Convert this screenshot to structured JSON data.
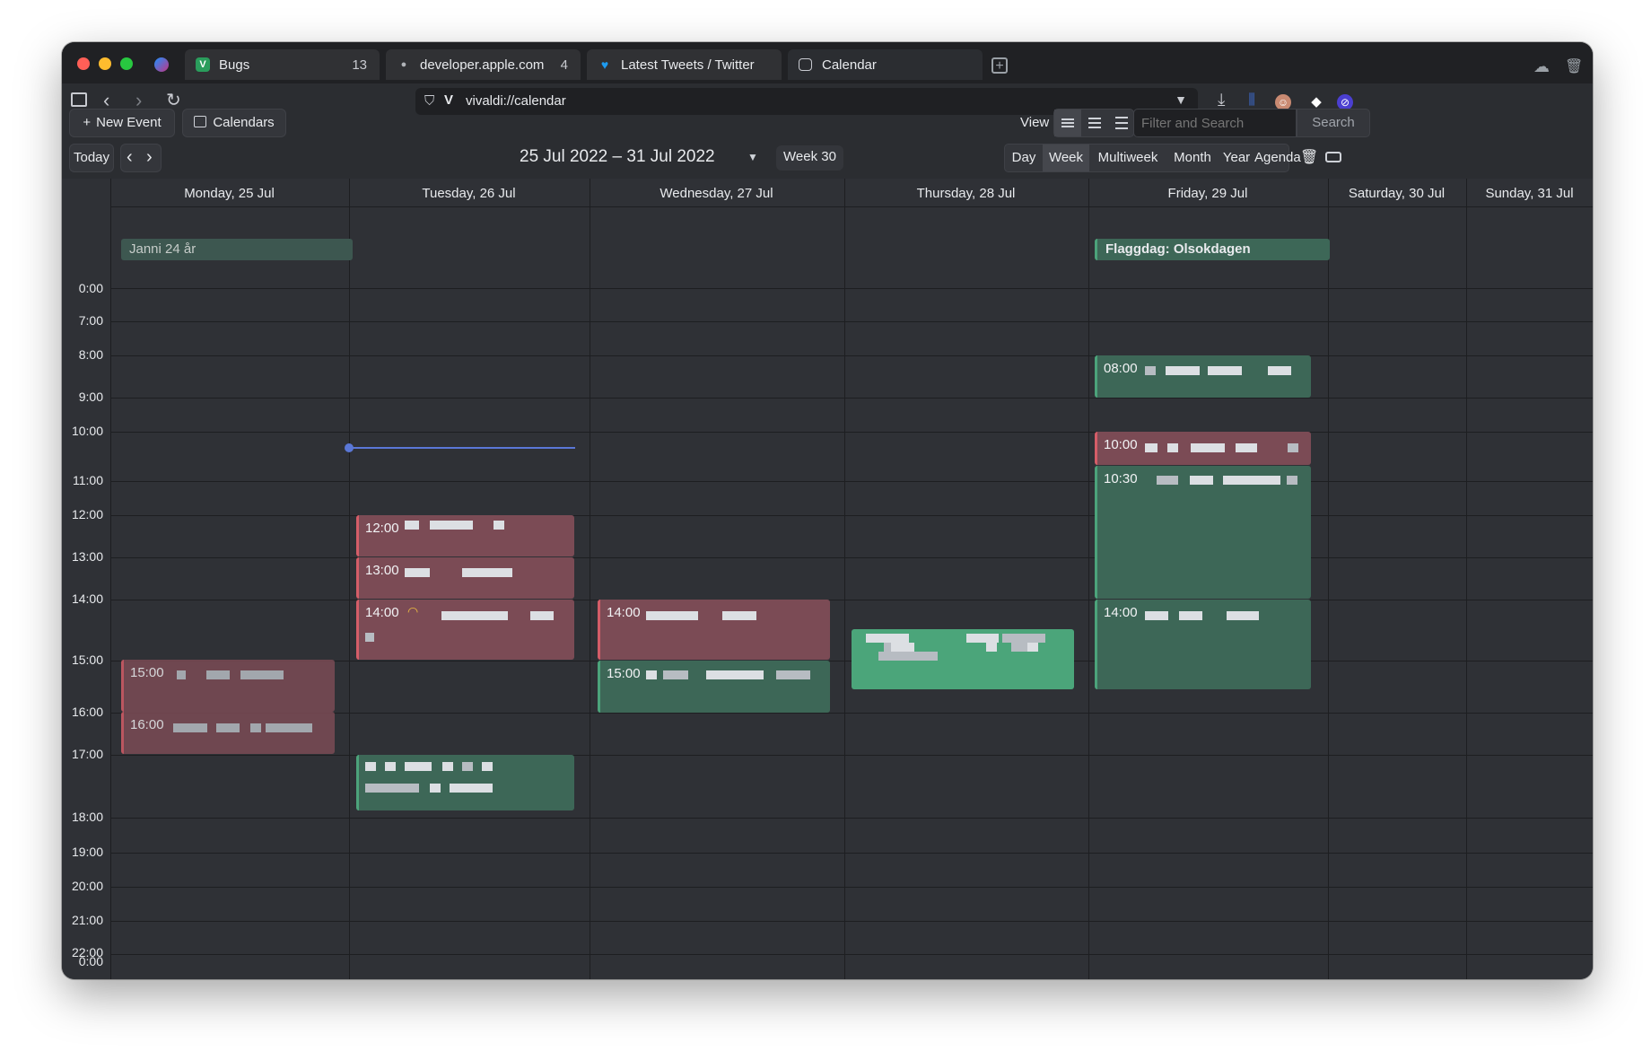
{
  "browser": {
    "tabs": [
      {
        "label": "Bugs",
        "count": "13"
      },
      {
        "label": "developer.apple.com",
        "count": "4"
      },
      {
        "label": "Latest Tweets / Twitter",
        "count": ""
      },
      {
        "label": "Calendar",
        "count": ""
      }
    ],
    "url": "vivaldi://calendar"
  },
  "toolbar": {
    "new_event": "New Event",
    "calendars": "Calendars",
    "view_label": "View",
    "search_placeholder": "Filter and Search",
    "search_button": "Search",
    "today": "Today",
    "date_range": "25 Jul 2022 – 31 Jul 2022",
    "week": "Week 30",
    "ranges": [
      "Day",
      "Week",
      "Multiweek",
      "Month",
      "Year",
      "Agenda"
    ],
    "active_range": "Week"
  },
  "days": [
    "Monday, 25 Jul",
    "Tuesday, 26 Jul",
    "Wednesday, 27 Jul",
    "Thursday, 28 Jul",
    "Friday, 29 Jul",
    "Saturday, 30 Jul",
    "Sunday, 31 Jul"
  ],
  "all_day_events": [
    {
      "day": "Monday, 25 Jul",
      "title": "Janni 24 år"
    },
    {
      "day": "Friday, 29 Jul",
      "title": "Flaggdag: Olsokdagen"
    }
  ],
  "time_labels": [
    "0:00",
    "7:00",
    "8:00",
    "9:00",
    "10:00",
    "11:00",
    "12:00",
    "13:00",
    "14:00",
    "15:00",
    "16:00",
    "17:00",
    "18:00",
    "19:00",
    "20:00",
    "21:00",
    "22:00",
    "0:00"
  ],
  "events": [
    {
      "day": "Monday, 25 Jul",
      "time": "15:00",
      "color": "red"
    },
    {
      "day": "Monday, 25 Jul",
      "time": "16:00",
      "color": "red"
    },
    {
      "day": "Tuesday, 26 Jul",
      "time": "12:00",
      "color": "red"
    },
    {
      "day": "Tuesday, 26 Jul",
      "time": "13:00",
      "color": "red"
    },
    {
      "day": "Tuesday, 26 Jul",
      "time": "14:00",
      "color": "red"
    },
    {
      "day": "Tuesday, 26 Jul",
      "time": "",
      "color": "green"
    },
    {
      "day": "Wednesday, 27 Jul",
      "time": "14:00",
      "color": "red"
    },
    {
      "day": "Wednesday, 27 Jul",
      "time": "15:00",
      "color": "green"
    },
    {
      "day": "Thursday, 28 Jul",
      "time": "",
      "color": "bright-green"
    },
    {
      "day": "Friday, 29 Jul",
      "time": "08:00",
      "color": "green"
    },
    {
      "day": "Friday, 29 Jul",
      "time": "10:00",
      "color": "red"
    },
    {
      "day": "Friday, 29 Jul",
      "time": "10:30",
      "color": "green"
    },
    {
      "day": "Friday, 29 Jul",
      "time": "14:00",
      "color": "green"
    }
  ],
  "colors": {
    "event_red": "#7b4b55",
    "event_green": "#3d6757",
    "event_bright_green": "#4ba57a",
    "now_indicator": "#5a77d6"
  },
  "icons": [
    "messenger-icon",
    "vivaldi-bugs-icon",
    "apple-icon",
    "twitter-icon",
    "calendar-icon",
    "new-tab-icon",
    "cloud-icon",
    "trash-icon",
    "panel-icon",
    "back-icon",
    "forward-icon",
    "reload-icon",
    "shield-icon",
    "download-icon",
    "plus-icon",
    "chevron-down-icon",
    "prev-icon",
    "next-icon",
    "delete-icon",
    "toggle-icon"
  ]
}
